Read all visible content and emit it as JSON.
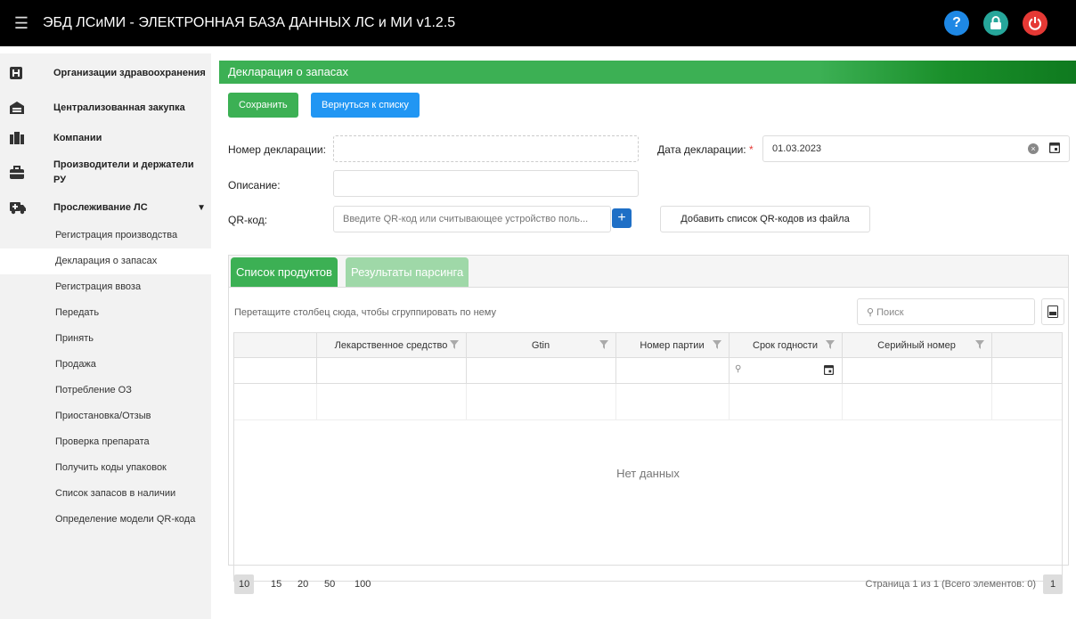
{
  "app": {
    "title": "ЭБД ЛСиМИ - ЭЛЕКТРОННАЯ БАЗА ДАННЫХ ЛС и МИ v1.2.5",
    "icons": [
      "menu-icon",
      "help-icon",
      "lock-icon",
      "power-icon"
    ],
    "colors": {
      "help": "#1e88e5",
      "lock": "#26a69a",
      "power": "#e53935",
      "primary_green": "#3cb054",
      "primary_blue": "#2196f3"
    }
  },
  "sidebar": {
    "items": [
      {
        "label": "Организации здравоохранения",
        "icon": "hospital-icon"
      },
      {
        "label": "Централизованная закупка",
        "icon": "warehouse-icon"
      },
      {
        "label": "Компании",
        "icon": "building-icon"
      },
      {
        "label": "Производители и держатели РУ",
        "icon": "briefcase-icon"
      },
      {
        "label": "Прослеживание ЛС",
        "icon": "ambulance-icon",
        "expanded": true
      }
    ],
    "subitems": [
      "Регистрация производства",
      "Декларация о запасах",
      "Регистрация ввоза",
      "Передать",
      "Принять",
      "Продажа",
      "Потребление ОЗ",
      "Приостановка/Отзыв",
      "Проверка препарата",
      "Получить коды упаковок",
      "Список запасов в наличии",
      "Определение модели QR-кода"
    ],
    "active_sub": "Декларация о запасах"
  },
  "main": {
    "header": "Декларация о запасах",
    "save_label": "Сохранить",
    "back_label": "Вернуться к списку",
    "decl_number_label": "Номер декларации:",
    "decl_number_value": "",
    "decl_date_label": "Дата декларации:",
    "required_mark": "*",
    "decl_date_value": "01.03.2023",
    "description_label": "Описание:",
    "description_value": "",
    "qr_label": "QR-код:",
    "qr_placeholder": "Введите QR-код или считывающее устройство поль...",
    "add_qr_file_label": "Добавить список QR-кодов из файла"
  },
  "tabs": [
    {
      "label": "Список продуктов",
      "active": true
    },
    {
      "label": "Результаты парсинга",
      "active": false
    }
  ],
  "grid": {
    "group_hint": "Перетащите столбец сюда, чтобы сгруппировать по нему",
    "search_placeholder": "Поиск",
    "columns": [
      "Лекарственное средство",
      "Gtin",
      "Номер партии",
      "Срок годности",
      "Серийный номер"
    ],
    "no_data": "Нет данных",
    "page_sizes": [
      "10",
      "15",
      "20",
      "50",
      "100"
    ],
    "selected_page_size": "10",
    "page_info": "Страница 1 из 1 (Всего элементов: 0)",
    "current_page": "1"
  }
}
